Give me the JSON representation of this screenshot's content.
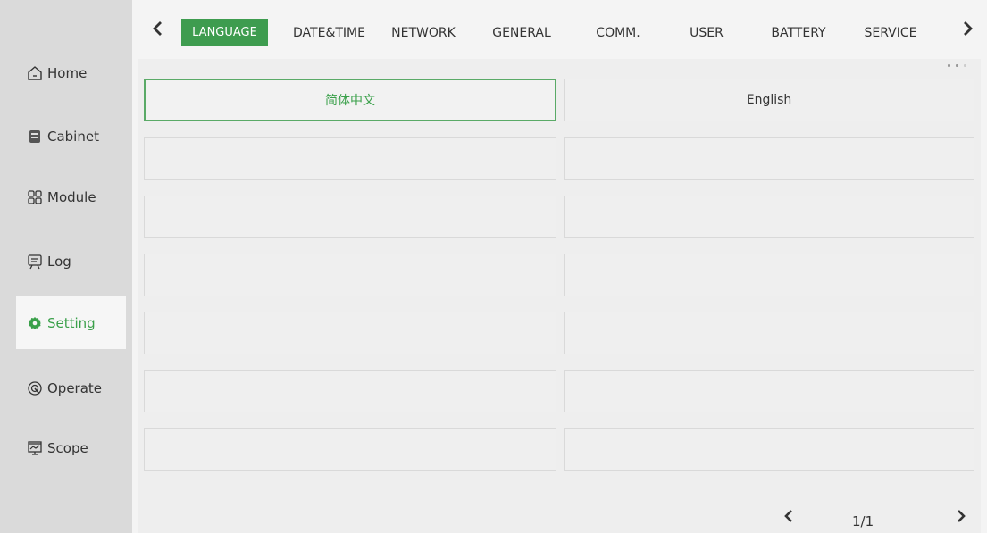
{
  "sidebar": {
    "items": [
      {
        "label": "Home",
        "icon": "home-icon"
      },
      {
        "label": "Cabinet",
        "icon": "cabinet-icon"
      },
      {
        "label": "Module",
        "icon": "module-icon"
      },
      {
        "label": "Log",
        "icon": "log-icon"
      },
      {
        "label": "Setting",
        "icon": "gear-icon",
        "active": true
      },
      {
        "label": "Operate",
        "icon": "operate-icon"
      },
      {
        "label": "Scope",
        "icon": "scope-icon"
      }
    ]
  },
  "tabs": {
    "items": [
      "LANGUAGE",
      "DATE&TIME",
      "NETWORK",
      "GENERAL",
      "COMM.",
      "USER",
      "BATTERY",
      "SERVICE"
    ],
    "active": "LANGUAGE"
  },
  "languages": {
    "options": [
      "简体中文",
      "English"
    ],
    "selected": "简体中文"
  },
  "pager": {
    "text": "1/1"
  },
  "colors": {
    "accent": "#3e9c4f",
    "sidebar_bg": "#dadada",
    "content_bg": "#eeeeee"
  }
}
